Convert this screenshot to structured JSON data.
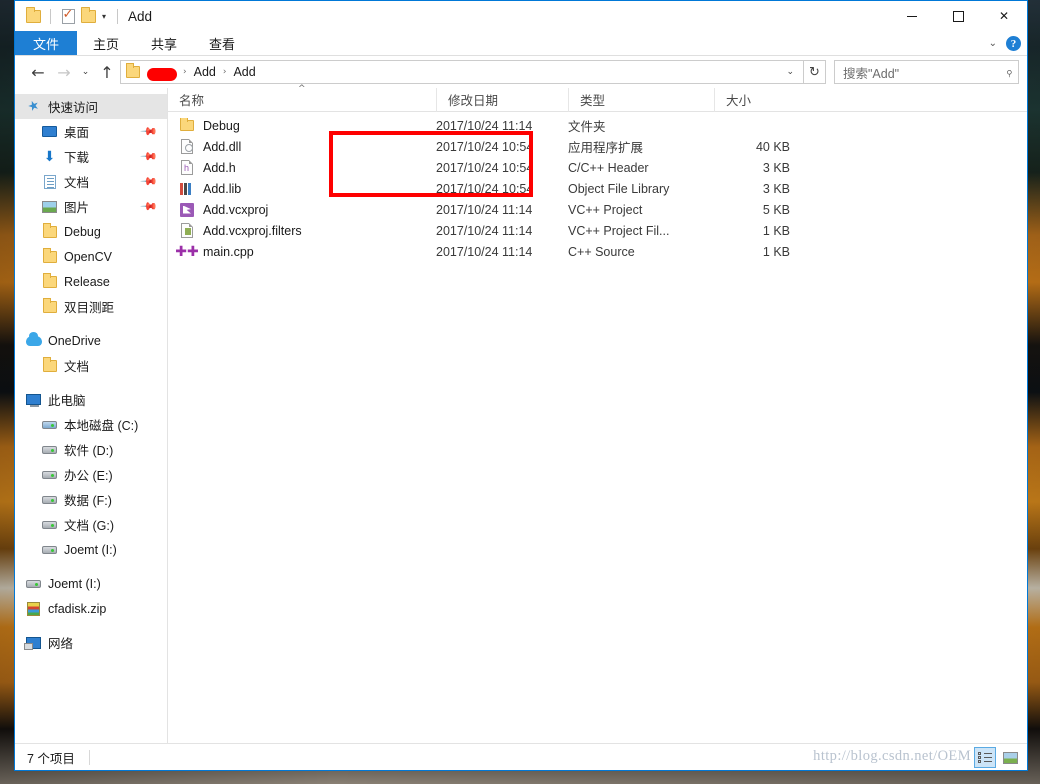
{
  "window": {
    "title": "Add",
    "quick_access_toolbar": [
      "folder-icon",
      "properties-icon",
      "new-folder-icon",
      "customize-caret"
    ],
    "controls": {
      "minimize": "–",
      "maximize": "□",
      "close": "✕"
    }
  },
  "ribbon": {
    "tabs": [
      {
        "label": "文件",
        "active": true
      },
      {
        "label": "主页",
        "active": false
      },
      {
        "label": "共享",
        "active": false
      },
      {
        "label": "查看",
        "active": false
      }
    ],
    "expand_caret": "⌄",
    "help_label": "?"
  },
  "address_bar": {
    "back": "←",
    "forward": "→",
    "history": "⌄",
    "up": "↑",
    "breadcrumbs": [
      "\u0000REDACTED\u0000",
      "Add",
      "Add"
    ],
    "separator": "›",
    "dropdown": "⌄",
    "refresh": "↻"
  },
  "search": {
    "placeholder": "搜索\"Add\"",
    "icon": "search-icon"
  },
  "sidebar": {
    "items": [
      {
        "label": "快速访问",
        "icon": "star-pin-icon",
        "level": 0,
        "selected": true,
        "pinned": false
      },
      {
        "label": "桌面",
        "icon": "desktop-icon",
        "level": 1,
        "selected": false,
        "pinned": true
      },
      {
        "label": "下载",
        "icon": "downloads-icon",
        "level": 1,
        "selected": false,
        "pinned": true
      },
      {
        "label": "文档",
        "icon": "documents-icon",
        "level": 1,
        "selected": false,
        "pinned": true
      },
      {
        "label": "图片",
        "icon": "pictures-icon",
        "level": 1,
        "selected": false,
        "pinned": true
      },
      {
        "label": "Debug",
        "icon": "folder-icon",
        "level": 1,
        "selected": false,
        "pinned": false
      },
      {
        "label": "OpenCV",
        "icon": "folder-icon",
        "level": 1,
        "selected": false,
        "pinned": false
      },
      {
        "label": "Release",
        "icon": "folder-icon",
        "level": 1,
        "selected": false,
        "pinned": false
      },
      {
        "label": "双目测距",
        "icon": "folder-icon",
        "level": 1,
        "selected": false,
        "pinned": false
      },
      {
        "label": "OneDrive",
        "icon": "onedrive-cloud-icon",
        "level": 0,
        "selected": false,
        "pinned": false
      },
      {
        "label": "文档",
        "icon": "folder-icon",
        "level": 1,
        "selected": false,
        "pinned": false
      },
      {
        "label": "此电脑",
        "icon": "this-pc-icon",
        "level": 0,
        "selected": false,
        "pinned": false
      },
      {
        "label": "本地磁盘 (C:)",
        "icon": "system-drive-icon",
        "level": 1,
        "selected": false,
        "pinned": false
      },
      {
        "label": "软件 (D:)",
        "icon": "drive-icon",
        "level": 1,
        "selected": false,
        "pinned": false
      },
      {
        "label": "办公 (E:)",
        "icon": "drive-icon",
        "level": 1,
        "selected": false,
        "pinned": false
      },
      {
        "label": "数据 (F:)",
        "icon": "drive-icon",
        "level": 1,
        "selected": false,
        "pinned": false
      },
      {
        "label": "文档 (G:)",
        "icon": "drive-icon",
        "level": 1,
        "selected": false,
        "pinned": false
      },
      {
        "label": "Joemt (I:)",
        "icon": "drive-icon",
        "level": 1,
        "selected": false,
        "pinned": false
      },
      {
        "label": "Joemt (I:)",
        "icon": "drive-icon",
        "level": 0,
        "selected": false,
        "pinned": false
      },
      {
        "label": "cfadisk.zip",
        "icon": "zip-icon",
        "level": 0,
        "selected": false,
        "pinned": false
      },
      {
        "label": "网络",
        "icon": "network-icon",
        "level": 0,
        "selected": false,
        "pinned": false
      }
    ]
  },
  "file_list": {
    "columns": [
      {
        "label": "名称",
        "key": "name",
        "sorted": "asc"
      },
      {
        "label": "修改日期",
        "key": "date"
      },
      {
        "label": "类型",
        "key": "type"
      },
      {
        "label": "大小",
        "key": "size"
      }
    ],
    "sort_indicator": "^",
    "rows": [
      {
        "name": "Debug",
        "date": "2017/10/24 11:14",
        "type": "文件夹",
        "size": "",
        "icon": "folder-icon"
      },
      {
        "name": "Add.dll",
        "date": "2017/10/24 10:54",
        "type": "应用程序扩展",
        "size": "40 KB",
        "icon": "dll-icon"
      },
      {
        "name": "Add.h",
        "date": "2017/10/24 10:54",
        "type": "C/C++ Header",
        "size": "3 KB",
        "icon": "header-file-icon"
      },
      {
        "name": "Add.lib",
        "date": "2017/10/24 10:54",
        "type": "Object File Library",
        "size": "3 KB",
        "icon": "lib-icon"
      },
      {
        "name": "Add.vcxproj",
        "date": "2017/10/24 11:14",
        "type": "VC++ Project",
        "size": "5 KB",
        "icon": "vcxproj-icon"
      },
      {
        "name": "Add.vcxproj.filters",
        "date": "2017/10/24 11:14",
        "type": "VC++ Project Fil...",
        "size": "1 KB",
        "icon": "filters-icon"
      },
      {
        "name": "main.cpp",
        "date": "2017/10/24 11:14",
        "type": "C++ Source",
        "size": "1 KB",
        "icon": "cpp-source-icon"
      }
    ]
  },
  "annotation": {
    "color": "#fe0000",
    "highlights": [
      "Add.dll",
      "Add.h",
      "Add.lib"
    ]
  },
  "status_bar": {
    "item_count": "7 个项目",
    "watermark": "http://blog.csdn.net/OEM",
    "views": [
      {
        "name": "details-view",
        "active": true
      },
      {
        "name": "large-icons-view",
        "active": false
      }
    ]
  }
}
